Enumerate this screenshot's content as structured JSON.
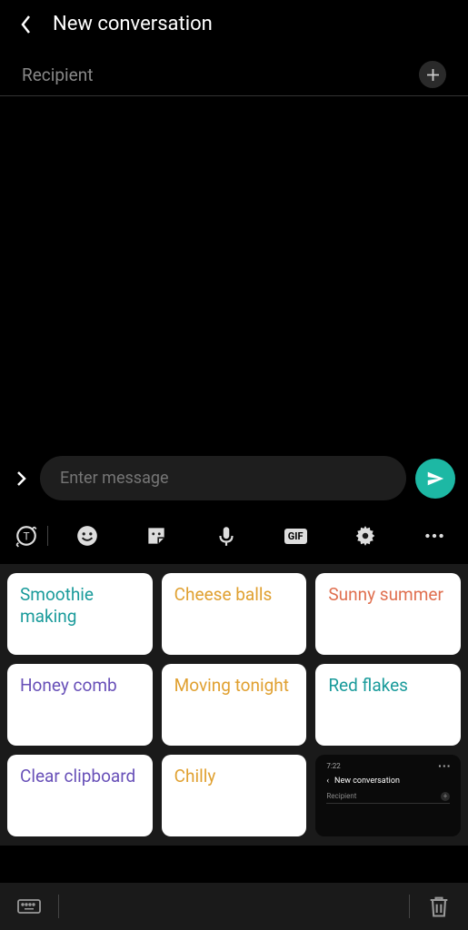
{
  "header": {
    "title": "New conversation"
  },
  "recipient": {
    "placeholder": "Recipient"
  },
  "compose": {
    "placeholder": "Enter message"
  },
  "toolbar": {
    "gif_label": "GIF"
  },
  "clipboard": {
    "items": [
      {
        "text": "Smoothie making",
        "color": "teal"
      },
      {
        "text": "Cheese balls",
        "color": "orange"
      },
      {
        "text": "Sunny summer",
        "color": "coral"
      },
      {
        "text": "Honey comb",
        "color": "purple"
      },
      {
        "text": "Moving tonight",
        "color": "orange"
      },
      {
        "text": "Red flakes",
        "color": "teal2"
      },
      {
        "text": "Clear clipboard",
        "color": "purple"
      },
      {
        "text": "Chilly",
        "color": "orange"
      }
    ],
    "screenshot": {
      "time": "7:22",
      "title": "New conversation",
      "recipient": "Recipient"
    }
  }
}
